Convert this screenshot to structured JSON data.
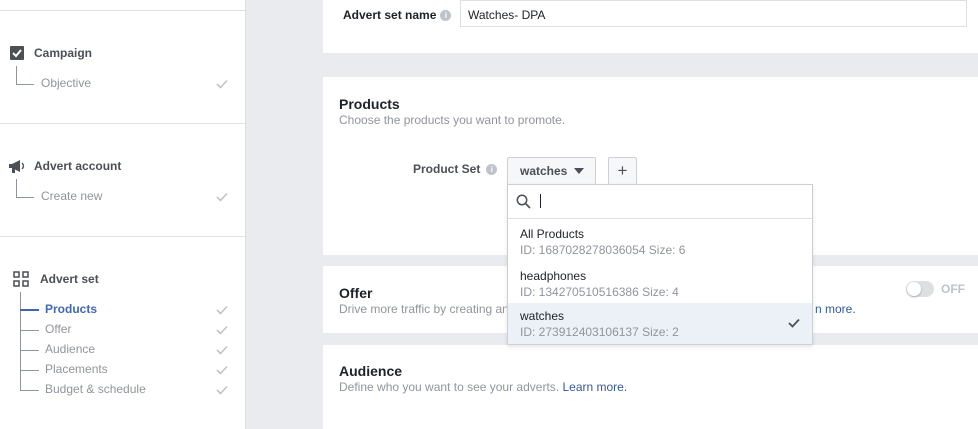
{
  "sidebar": {
    "campaign": {
      "title": "Campaign",
      "items": [
        {
          "label": "Objective"
        }
      ]
    },
    "advert_account": {
      "title": "Advert account",
      "items": [
        {
          "label": "Create new"
        }
      ]
    },
    "advert_set": {
      "title": "Advert set",
      "items": [
        {
          "label": "Products"
        },
        {
          "label": "Offer"
        },
        {
          "label": "Audience"
        },
        {
          "label": "Placements"
        },
        {
          "label": "Budget & schedule"
        }
      ]
    }
  },
  "name_section": {
    "label": "Advert set name",
    "value": "Watches- DPA"
  },
  "products": {
    "title": "Products",
    "subtitle": "Choose the products you want to promote.",
    "product_set_label": "Product Set",
    "selected": "watches",
    "add_symbol": "+"
  },
  "dropdown": {
    "search_value": "",
    "options": [
      {
        "name": "All Products",
        "meta": "ID: 1687028278036054 Size: 6",
        "selected": false
      },
      {
        "name": "headphones",
        "meta": "ID: 134270510516386 Size: 4",
        "selected": false
      },
      {
        "name": "watches",
        "meta": "ID: 273912403106137 Size: 2",
        "selected": true
      }
    ]
  },
  "offer": {
    "title": "Offer",
    "subtitle_start": "Drive more traffic by creating an",
    "link_tail": "n more.",
    "toggle_label": "OFF"
  },
  "audience": {
    "title": "Audience",
    "subtitle": "Define who you want to see your adverts.",
    "link": "Learn more."
  },
  "colors": {
    "accent": "#4267b2",
    "link": "#365899",
    "muted": "#90949c",
    "background": "#e9ebee"
  }
}
